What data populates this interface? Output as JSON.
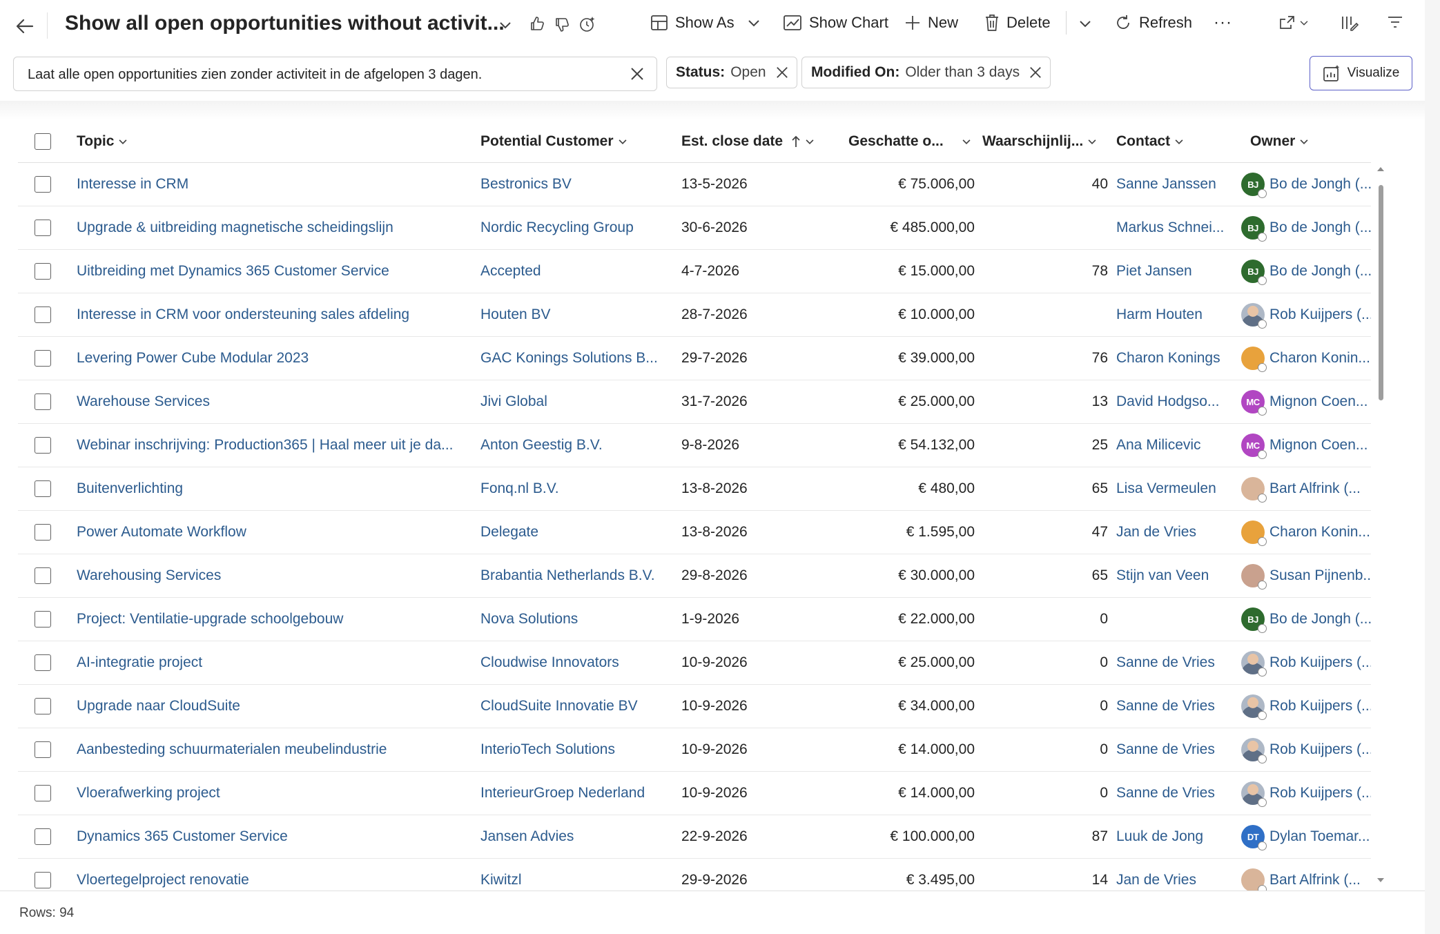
{
  "header": {
    "view_title": "Show all open opportunities without activit...",
    "commands": {
      "show_as": "Show As",
      "show_chart": "Show Chart",
      "new": "New",
      "delete": "Delete",
      "refresh": "Refresh",
      "more": "···"
    }
  },
  "filters": {
    "query": "Laat alle open opportunities zien zonder activiteit in de afgelopen 3 dagen.",
    "chips": [
      {
        "key": "Status:",
        "value": "Open"
      },
      {
        "key": "Modified On:",
        "value": "Older than 3 days"
      }
    ],
    "visualize_label": "Visualize"
  },
  "grid": {
    "columns": {
      "topic": "Topic",
      "customer": "Potential Customer",
      "close_date": "Est. close date",
      "revenue": "Geschatte o...",
      "probability": "Waarschijnlij...",
      "contact": "Contact",
      "owner": "Owner"
    },
    "rows": [
      {
        "topic": "Interesse in CRM",
        "customer": "Bestronics BV",
        "date": "13-5-2026",
        "revenue": "€ 75.006,00",
        "prob": "40",
        "contact": "Sanne Janssen",
        "owner": "Bo de Jongh (...",
        "initials": "BJ",
        "avatar_color": "#2e6b2e"
      },
      {
        "topic": "Upgrade & uitbreiding magnetische scheidingslijn",
        "customer": "Nordic Recycling Group",
        "date": "30-6-2026",
        "revenue": "€ 485.000,00",
        "prob": "",
        "contact": "Markus Schnei...",
        "owner": "Bo de Jongh (...",
        "initials": "BJ",
        "avatar_color": "#2e6b2e"
      },
      {
        "topic": "Uitbreiding met Dynamics 365 Customer Service",
        "customer": "Accepted",
        "date": "4-7-2026",
        "revenue": "€ 15.000,00",
        "prob": "78",
        "contact": "Piet Jansen",
        "owner": "Bo de Jongh (...",
        "initials": "BJ",
        "avatar_color": "#2e6b2e"
      },
      {
        "topic": "Interesse in CRM voor ondersteuning sales afdeling",
        "customer": "Houten BV",
        "date": "28-7-2026",
        "revenue": "€ 10.000,00",
        "prob": "",
        "contact": "Harm Houten",
        "owner": "Rob Kuijpers (...",
        "initials": "",
        "avatar_color": "photo"
      },
      {
        "topic": "Levering Power Cube Modular 2023",
        "customer": "GAC Konings Solutions B...",
        "date": "29-7-2026",
        "revenue": "€ 39.000,00",
        "prob": "76",
        "contact": "Charon Konings",
        "owner": "Charon Konin...",
        "initials": "",
        "avatar_color": "#e8a23c"
      },
      {
        "topic": "Warehouse Services",
        "customer": "Jivi Global",
        "date": "31-7-2026",
        "revenue": "€ 25.000,00",
        "prob": "13",
        "contact": "David Hodgso...",
        "owner": "Mignon Coen...",
        "initials": "MC",
        "avatar_color": "#b146c2"
      },
      {
        "topic": "Webinar inschrijving: Production365 | Haal meer uit je da...",
        "customer": "Anton Geestig B.V.",
        "date": "9-8-2026",
        "revenue": "€ 54.132,00",
        "prob": "25",
        "contact": "Ana Milicevic",
        "owner": "Mignon Coen...",
        "initials": "MC",
        "avatar_color": "#b146c2"
      },
      {
        "topic": "Buitenverlichting",
        "customer": "Fonq.nl B.V.",
        "date": "13-8-2026",
        "revenue": "€ 480,00",
        "prob": "65",
        "contact": "Lisa Vermeulen",
        "owner": "Bart Alfrink (...",
        "initials": "",
        "avatar_color": "#d9b59a"
      },
      {
        "topic": "Power Automate Workflow",
        "customer": "Delegate",
        "date": "13-8-2026",
        "revenue": "€ 1.595,00",
        "prob": "47",
        "contact": "Jan de Vries",
        "owner": "Charon Konin...",
        "initials": "",
        "avatar_color": "#e8a23c"
      },
      {
        "topic": "Warehousing Services",
        "customer": "Brabantia Netherlands B.V.",
        "date": "29-8-2026",
        "revenue": "€ 30.000,00",
        "prob": "65",
        "contact": "Stijn van Veen",
        "owner": "Susan Pijnenb...",
        "initials": "",
        "avatar_color": "#c9a18e"
      },
      {
        "topic": "Project: Ventilatie-upgrade schoolgebouw",
        "customer": "Nova Solutions",
        "date": "1-9-2026",
        "revenue": "€ 22.000,00",
        "prob": "0",
        "contact": "",
        "owner": "Bo de Jongh (...",
        "initials": "BJ",
        "avatar_color": "#2e6b2e"
      },
      {
        "topic": "AI-integratie project",
        "customer": "Cloudwise Innovators",
        "date": "10-9-2026",
        "revenue": "€ 25.000,00",
        "prob": "0",
        "contact": "Sanne de Vries",
        "owner": "Rob Kuijpers (...",
        "initials": "",
        "avatar_color": "photo"
      },
      {
        "topic": "Upgrade naar CloudSuite",
        "customer": "CloudSuite Innovatie BV",
        "date": "10-9-2026",
        "revenue": "€ 34.000,00",
        "prob": "0",
        "contact": "Sanne de Vries",
        "owner": "Rob Kuijpers (...",
        "initials": "",
        "avatar_color": "photo"
      },
      {
        "topic": "Aanbesteding schuurmaterialen meubelindustrie",
        "customer": "InterioTech Solutions",
        "date": "10-9-2026",
        "revenue": "€ 14.000,00",
        "prob": "0",
        "contact": "Sanne de Vries",
        "owner": "Rob Kuijpers (...",
        "initials": "",
        "avatar_color": "photo"
      },
      {
        "topic": "Vloerafwerking project",
        "customer": "InterieurGroep Nederland",
        "date": "10-9-2026",
        "revenue": "€ 14.000,00",
        "prob": "0",
        "contact": "Sanne de Vries",
        "owner": "Rob Kuijpers (...",
        "initials": "",
        "avatar_color": "photo"
      },
      {
        "topic": "Dynamics 365 Customer Service",
        "customer": "Jansen Advies",
        "date": "22-9-2026",
        "revenue": "€ 100.000,00",
        "prob": "87",
        "contact": "Luuk de Jong",
        "owner": "Dylan Toemar...",
        "initials": "DT",
        "avatar_color": "#2f6fc6"
      },
      {
        "topic": "Vloertegelproject renovatie",
        "customer": "Kiwitzl",
        "date": "29-9-2026",
        "revenue": "€ 3.495,00",
        "prob": "14",
        "contact": "Jan de Vries",
        "owner": "Bart Alfrink (...",
        "initials": "",
        "avatar_color": "#d9b59a"
      }
    ]
  },
  "footer": {
    "rows_label": "Rows: 94"
  }
}
